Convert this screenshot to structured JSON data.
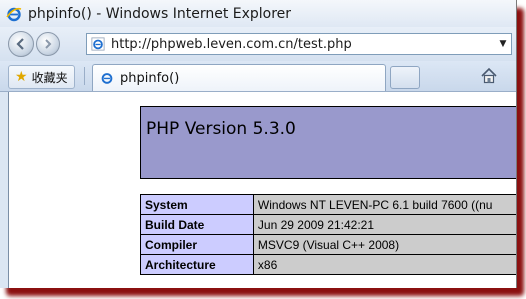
{
  "window": {
    "title": "phpinfo() - Windows Internet Explorer"
  },
  "address_bar": {
    "url": "http://phpweb.leven.com.cn/test.php"
  },
  "toolbar": {
    "favorites_label": "收藏夹"
  },
  "tabs": [
    {
      "label": "phpinfo()"
    }
  ],
  "page": {
    "header_title": "PHP Version 5.3.0",
    "rows": [
      {
        "key": "System",
        "value": "Windows NT LEVEN-PC 6.1 build 7600 ((nu"
      },
      {
        "key": "Build Date",
        "value": "Jun 29 2009 21:42:21"
      },
      {
        "key": "Compiler",
        "value": "MSVC9 (Visual C++ 2008)"
      },
      {
        "key": "Architecture",
        "value": "x86"
      }
    ]
  },
  "colors": {
    "header_bg": "#9999cc",
    "key_bg": "#ccccff",
    "value_bg": "#cccccc"
  }
}
